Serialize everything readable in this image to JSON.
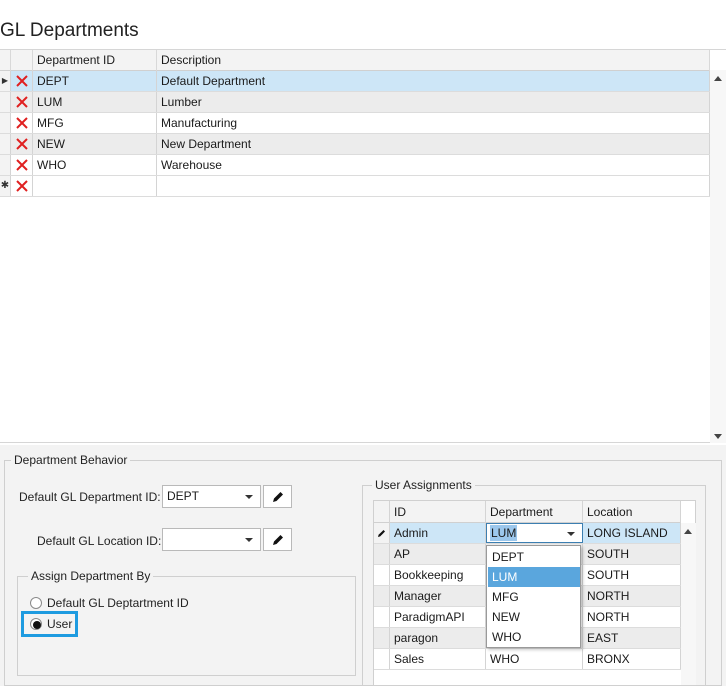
{
  "page": {
    "title": "GL Departments"
  },
  "departments_grid": {
    "columns": [
      "Department ID",
      "Description"
    ],
    "rows": [
      {
        "id": "DEPT",
        "description": "Default Department"
      },
      {
        "id": "LUM",
        "description": "Lumber"
      },
      {
        "id": "MFG",
        "description": "Manufacturing"
      },
      {
        "id": "NEW",
        "description": "New Department"
      },
      {
        "id": "WHO",
        "description": "Warehouse"
      },
      {
        "id": "",
        "description": ""
      }
    ]
  },
  "department_behavior": {
    "group_label": "Department Behavior",
    "default_dept_label": "Default GL Department ID:",
    "default_dept_value": "DEPT",
    "default_location_label": "Default GL Location ID:",
    "default_location_value": "",
    "assign_by": {
      "group_label": "Assign Department By",
      "options": [
        "Default GL Deptartment ID",
        "User"
      ],
      "selected": "User"
    }
  },
  "user_assignments": {
    "group_label": "User Assignments",
    "columns": [
      "ID",
      "Department",
      "Location"
    ],
    "rows": [
      {
        "id": "Admin",
        "department": "LUM",
        "location": "LONG ISLAND"
      },
      {
        "id": "AP",
        "department": "",
        "location": "SOUTH"
      },
      {
        "id": "Bookkeeping",
        "department": "",
        "location": "SOUTH"
      },
      {
        "id": "Manager",
        "department": "",
        "location": "NORTH"
      },
      {
        "id": "ParadigmAPI",
        "department": "",
        "location": "NORTH"
      },
      {
        "id": "paragon",
        "department": "",
        "location": "EAST"
      },
      {
        "id": "Sales",
        "department": "WHO",
        "location": "BRONX"
      }
    ],
    "dropdown_options": [
      "DEPT",
      "LUM",
      "MFG",
      "NEW",
      "WHO"
    ],
    "dropdown_selected": "LUM"
  },
  "colors": {
    "selection": "#cde6f7",
    "delete_icon": "#e02020",
    "dropdown_highlight": "#5aa6dd",
    "callout_border": "#1e9be0"
  }
}
